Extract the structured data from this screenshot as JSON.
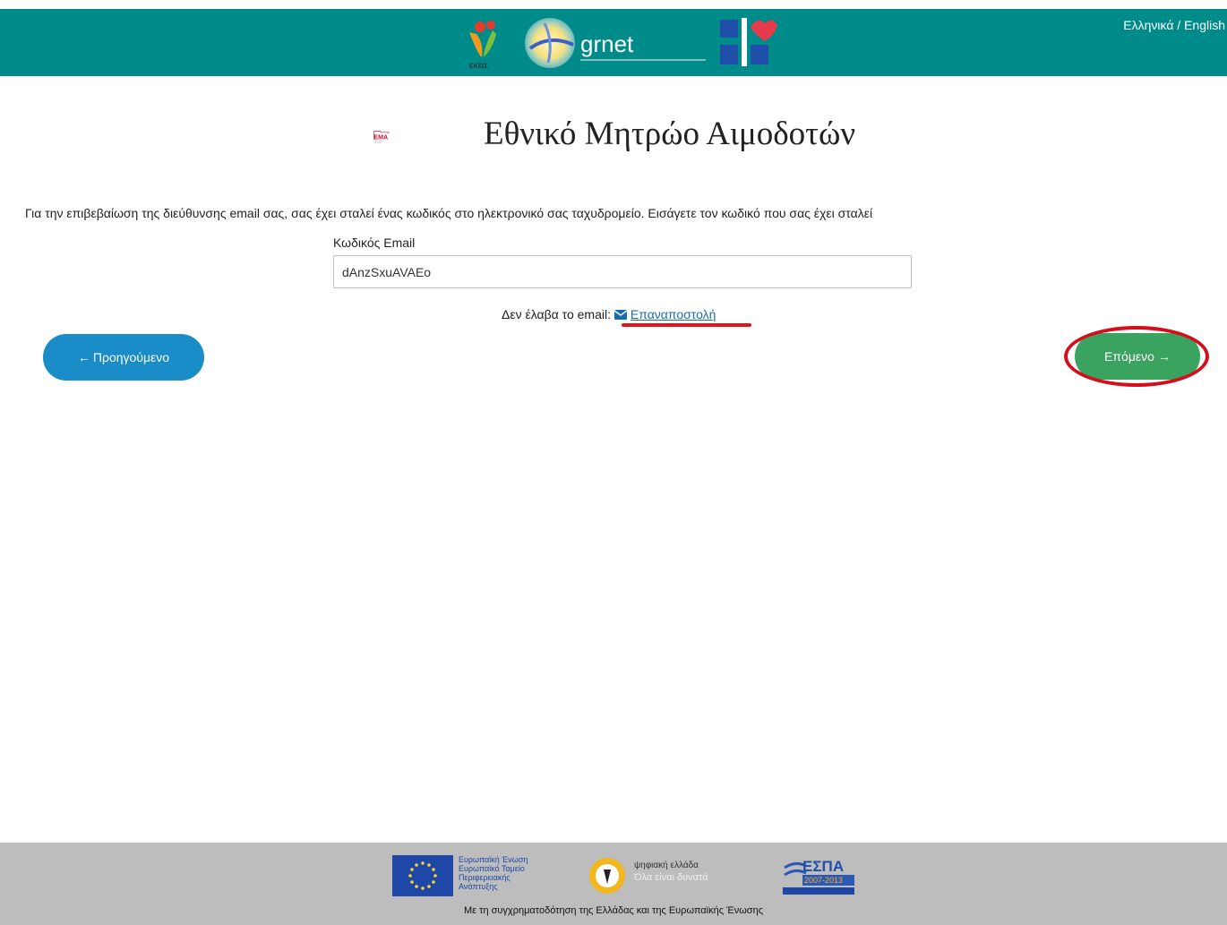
{
  "header": {
    "lang_switch": "Ελληνικά / English",
    "logos": {
      "ekea": "εκεα.",
      "grnet": "grnet"
    },
    "bg_color": "#008b8b"
  },
  "brand": {
    "logo_text": "ΕΜΑ",
    "logo_subtext_1": "ΕΘΝΙΚΟ ΜΗΤΡΩΟ",
    "logo_subtext_2": "ΑΙΜΟΔΟΤΩΝ",
    "title": "Εθνικό Μητρώο Αιμοδοτών"
  },
  "form": {
    "instructions": "Για την επιβεβαίωση της διεύθυνσης email σας, σας έχει σταλεί ένας κωδικός στο ηλεκτρονικό σας ταχυδρομείο. Εισάγετε τον κωδικό που σας έχει σταλεί",
    "code_label": "Κωδικός Email",
    "code_value": "dAnzSxuAVAEo",
    "resend_prompt": "Δεν έλαβα το email:",
    "resend_link": "Επαναποστολή"
  },
  "nav": {
    "prev_label": "Προηγούμενο",
    "next_label": "Επόμενο",
    "prev_color": "#1a8cc8",
    "next_color": "#3aa35f"
  },
  "footer": {
    "eu_text": [
      "Ευρωπαϊκή Ένωση",
      "Ευρωπαϊκό Ταμείο",
      "Περιφερειακής",
      "Ανάπτυξης"
    ],
    "digital_text": "ψηφιακή ελλάδα",
    "digital_sub": "Όλα είναι δυνατά",
    "espa_label": "ΕΣΠΑ",
    "espa_years": "2007-2013",
    "cofinancing": "Με τη συγχρηματοδότηση της Ελλάδας και της Ευρωπαϊκής Ένωσης"
  }
}
